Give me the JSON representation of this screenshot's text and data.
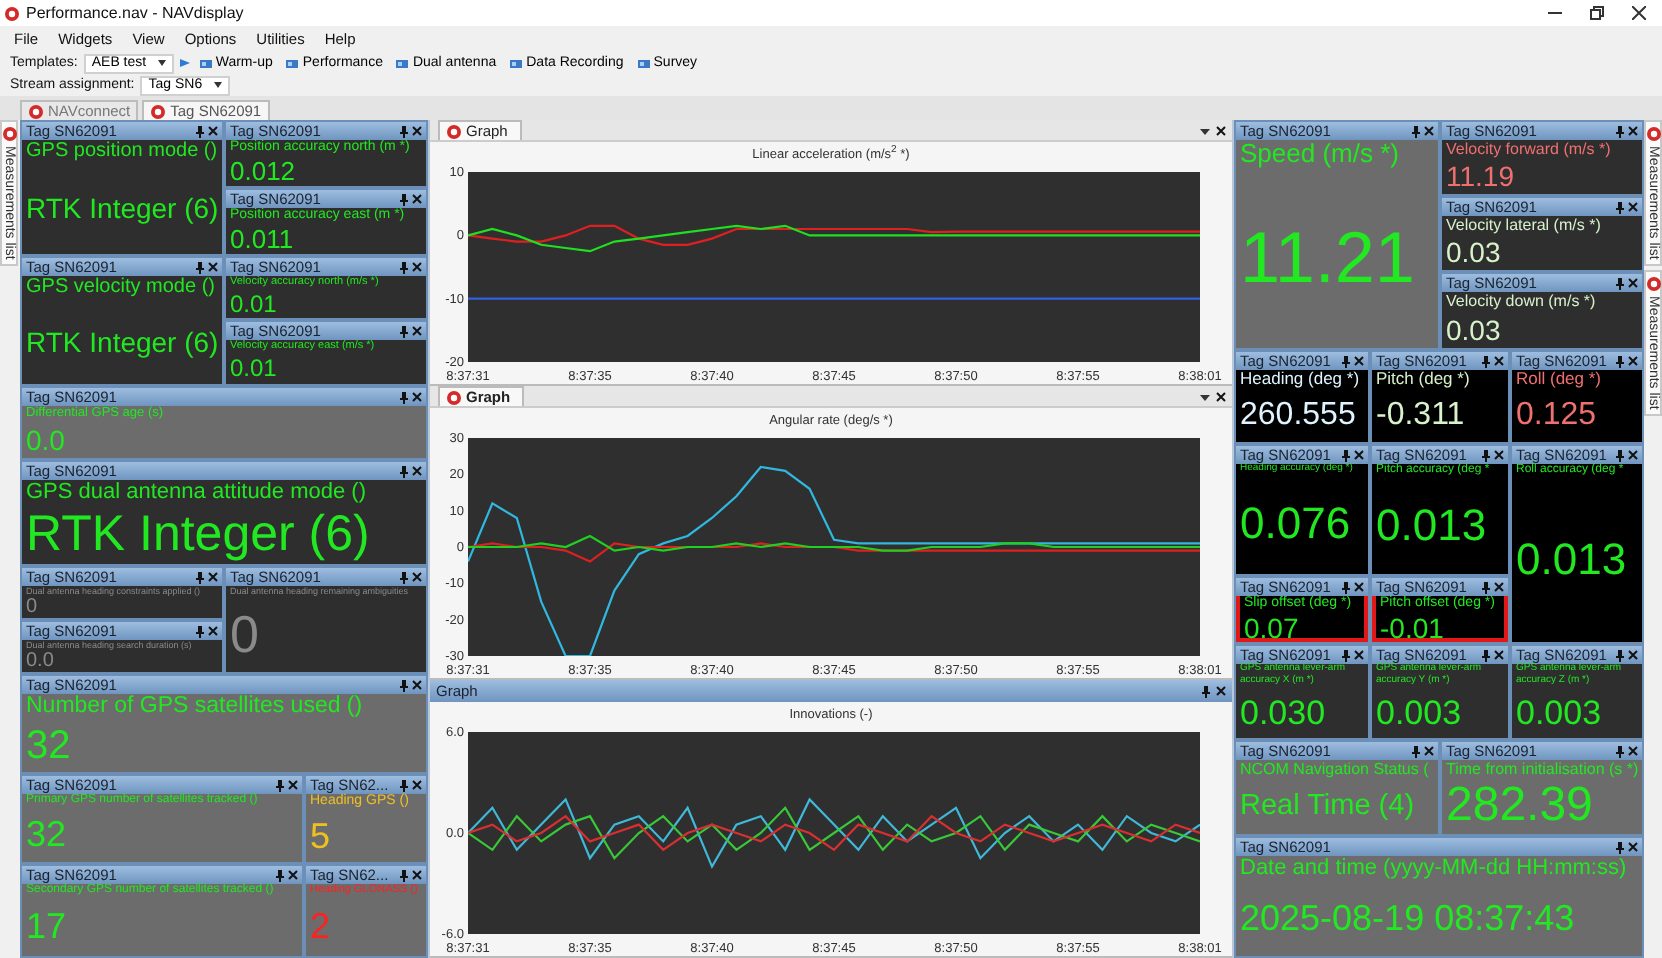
{
  "window": {
    "title": "Performance.nav - NAVdisplay"
  },
  "menu": [
    "File",
    "Widgets",
    "View",
    "Options",
    "Utilities",
    "Help"
  ],
  "toolbar": {
    "templates_label": "Templates:",
    "template": "AEB test",
    "buttons": [
      "Warm-up",
      "Performance",
      "Dual antenna",
      "Data Recording",
      "Survey"
    ],
    "stream_label": "Stream assignment:",
    "stream": "Tag SN6"
  },
  "doc_tabs": [
    {
      "label": "NAVconnect",
      "selected": false
    },
    {
      "label": "Tag SN62091",
      "selected": true
    }
  ],
  "side_tabs": {
    "left": [
      "Measurements list"
    ],
    "right": [
      "Measurements list",
      "Measurements list"
    ]
  },
  "left_widgets": [
    {
      "tag": "Tag SN62091",
      "label": "GPS position mode ()",
      "value": "RTK Integer (6)",
      "color": "#22e822",
      "kind": "dark",
      "highlighted": false
    },
    {
      "tag": "Tag SN62091",
      "label": "Position accuracy north (m *)",
      "value": "0.012",
      "color": "#22e822",
      "kind": "dark",
      "highlighted": false
    },
    {
      "tag": "Tag SN62091",
      "label": "Position accuracy east (m *)",
      "value": "0.011",
      "color": "#22e822",
      "kind": "dark",
      "highlighted": false
    },
    {
      "tag": "Tag SN62091",
      "label": "GPS velocity mode ()",
      "value": "RTK Integer (6)",
      "color": "#22e822",
      "kind": "dark",
      "highlighted": false
    },
    {
      "tag": "Tag SN62091",
      "label": "Velocity accuracy north (m/s *)",
      "value": "0.01",
      "color": "#22e822",
      "kind": "dark",
      "highlighted": false
    },
    {
      "tag": "Tag SN62091",
      "label": "Velocity accuracy east (m/s *)",
      "value": "0.01",
      "color": "#22e822",
      "kind": "dark",
      "highlighted": false
    },
    {
      "tag": "Tag SN62091",
      "label": "Differential GPS age (s)",
      "value": "0.0",
      "color": "#22e822",
      "kind": "gray",
      "highlighted": false
    },
    {
      "tag": "Tag SN62091",
      "label": "GPS dual antenna attitude mode ()",
      "value": "RTK Integer (6)",
      "color": "#22e822",
      "kind": "dark",
      "highlighted": false
    },
    {
      "tag": "Tag SN62091",
      "label": "Dual antenna heading constraints applied ()",
      "value": "0",
      "color": "#8a8a8a",
      "kind": "dark",
      "highlighted": false
    },
    {
      "tag": "Tag SN62091",
      "label": "Dual antenna heading remaining ambiguities",
      "value": "0",
      "color": "#8a8a8a",
      "kind": "dark",
      "highlighted": false
    },
    {
      "tag": "Tag SN62091",
      "label": "Dual antenna heading search duration (s)",
      "value": "0.0",
      "color": "#8a8a8a",
      "kind": "dark",
      "highlighted": false
    },
    {
      "tag": "Tag SN62091",
      "label": "Number of GPS satellites used ()",
      "value": "32",
      "color": "#22e822",
      "kind": "gray",
      "highlighted": false
    },
    {
      "tag": "Tag SN62091",
      "label": "Primary GPS number of satellites tracked ()",
      "value": "32",
      "color": "#22e822",
      "kind": "gray",
      "highlighted": false
    },
    {
      "tag": "Tag SN62...",
      "label": "Heading GPS ()",
      "value": "5",
      "color": "#f0c020",
      "kind": "gray",
      "highlighted": false
    },
    {
      "tag": "Tag SN62091",
      "label": "Secondary GPS number of satellites tracked ()",
      "value": "17",
      "color": "#22e822",
      "kind": "gray",
      "highlighted": false
    },
    {
      "tag": "Tag SN62...",
      "label": "Heading GLONASS ()",
      "value": "2",
      "color": "#ff2020",
      "kind": "gray",
      "highlighted": false
    }
  ],
  "graphs": [
    {
      "kind": "tabbed",
      "tab": "Graph",
      "selected": false,
      "chart_data": {
        "type": "line",
        "title": "Linear acceleration (m/s$^{2}$ *)",
        "categories": [
          "8:37:31",
          null,
          null,
          null,
          null,
          "8:37:35",
          null,
          null,
          null,
          null,
          "8:37:40",
          null,
          null,
          null,
          null,
          "8:37:45",
          null,
          null,
          null,
          null,
          "8:37:50",
          null,
          null,
          null,
          null,
          "8:37:55",
          null,
          null,
          null,
          null,
          "8:38:01"
        ],
        "ylim": [
          -20,
          10
        ],
        "yticks": [
          -20,
          -10,
          0,
          10
        ],
        "series": [
          {
            "color": "#e02020",
            "values": [
              0,
              -0.5,
              -1,
              -1,
              0,
              1.5,
              1.5,
              -0.5,
              -1.5,
              -1.5,
              -0.5,
              1,
              1,
              1,
              1,
              1,
              1,
              1,
              1,
              0.5,
              0.6,
              0.6,
              0.6,
              0.6,
              0.6,
              0.6,
              0.6,
              0.6,
              0.6,
              0.6,
              0.6
            ]
          },
          {
            "color": "#20e020",
            "values": [
              0,
              1,
              0,
              -1.5,
              -2,
              -2.5,
              -1,
              -0.5,
              0,
              0.5,
              1,
              1.5,
              1,
              1.5,
              0,
              0,
              0,
              0,
              0,
              0,
              0,
              0,
              0,
              0,
              0,
              0,
              0,
              0,
              0,
              0,
              0
            ]
          },
          {
            "color": "#3060e0",
            "values": [
              -10,
              -10,
              -10,
              -10,
              -10,
              -10,
              -10,
              -10,
              -10,
              -10,
              -10,
              -10,
              -10,
              -10,
              -10,
              -10,
              -10,
              -10,
              -10,
              -10,
              -10,
              -10,
              -10,
              -10,
              -10,
              -10,
              -10,
              -10,
              -10,
              -10,
              -10
            ]
          }
        ]
      }
    },
    {
      "kind": "tabbed",
      "tab": "Graph",
      "selected": true,
      "chart_data": {
        "type": "line",
        "title": "Angular rate (deg/s *)",
        "categories": [
          "8:37:31",
          null,
          null,
          null,
          null,
          "8:37:35",
          null,
          null,
          null,
          null,
          "8:37:40",
          null,
          null,
          null,
          null,
          "8:37:45",
          null,
          null,
          null,
          null,
          "8:37:50",
          null,
          null,
          null,
          null,
          "8:37:55",
          null,
          null,
          null,
          null,
          "8:38:01"
        ],
        "ylim": [
          -30,
          30
        ],
        "yticks": [
          -30,
          -20,
          -10,
          0,
          10,
          20,
          30
        ],
        "series": [
          {
            "color": "#30b8e0",
            "values": [
              -4,
              12,
              8,
              -15,
              -30,
              -30,
              -12,
              -2,
              1,
              3,
              8,
              14,
              22,
              21,
              16,
              2,
              1,
              1,
              1,
              1,
              1,
              1,
              1,
              1,
              1,
              1,
              1,
              1,
              1,
              1,
              1
            ]
          },
          {
            "color": "#e02020",
            "values": [
              0,
              1,
              0,
              0,
              -1,
              -4,
              1,
              0,
              0,
              0,
              0,
              0,
              1,
              0,
              0,
              0,
              -1,
              -1,
              -1,
              -1,
              -1,
              -1,
              -1,
              -1,
              -1,
              -1,
              -1,
              -1,
              -1,
              -1,
              -1
            ]
          },
          {
            "color": "#20d020",
            "values": [
              0,
              0,
              0,
              1,
              0,
              3,
              -1,
              0,
              -1,
              0,
              0,
              1,
              0,
              1,
              0,
              0,
              0,
              -1,
              -1,
              0,
              0,
              0,
              1,
              1,
              0,
              0,
              0,
              0,
              0,
              0,
              0
            ]
          }
        ]
      }
    },
    {
      "kind": "bar",
      "tab": "Graph",
      "chart_data": {
        "type": "line",
        "title": "Innovations (-)",
        "categories": [
          "8:37:31",
          null,
          null,
          null,
          null,
          "8:37:35",
          null,
          null,
          null,
          null,
          "8:37:40",
          null,
          null,
          null,
          null,
          "8:37:45",
          null,
          null,
          null,
          null,
          "8:37:50",
          null,
          null,
          null,
          null,
          "8:37:55",
          null,
          null,
          null,
          null,
          "8:38:01"
        ],
        "ylim": [
          -6,
          6
        ],
        "yticks": [
          {
            "value": -6,
            "label": "-6.0"
          },
          {
            "value": 0,
            "label": "0.0"
          },
          {
            "value": 6,
            "label": "6.0"
          }
        ],
        "series": [
          {
            "color": "#40b8d8",
            "values": [
              0,
              1.5,
              -1,
              0.5,
              2,
              -1.5,
              0.5,
              1,
              -0.5,
              1.5,
              -2,
              0.5,
              1,
              -1,
              2,
              0.5,
              -1,
              1,
              -0.5,
              0.5,
              1.5,
              -1.5,
              0,
              1,
              -0.5,
              0.5,
              -1,
              1,
              0,
              -0.5,
              0.5
            ]
          },
          {
            "color": "#38c838",
            "values": [
              0,
              -1,
              1,
              -0.5,
              0.5,
              1,
              -1.5,
              0,
              1,
              -0.5,
              0.5,
              -1,
              0,
              1.5,
              -1,
              0,
              1,
              -1,
              0.5,
              -0.5,
              0,
              1,
              -1,
              0.5,
              0,
              -0.5,
              1,
              -0.5,
              0.5,
              0,
              -0.5
            ]
          },
          {
            "color": "#d83030",
            "values": [
              0,
              0.5,
              -0.5,
              0,
              1,
              -0.5,
              0,
              0.5,
              -1,
              0,
              0.5,
              0,
              -0.5,
              0.5,
              0,
              -1,
              0.5,
              0,
              -0.5,
              1,
              0,
              -0.5,
              0.5,
              0,
              -0.5,
              0,
              0.5,
              0,
              -0.5,
              0.5,
              0
            ]
          }
        ]
      }
    }
  ],
  "right_widgets": [
    {
      "tag": "Tag SN62091",
      "label": "Speed (m/s *)",
      "value": "11.21",
      "color": "#22e822",
      "kind": "gray",
      "highlighted": false
    },
    {
      "tag": "Tag SN62091",
      "label": "Velocity forward (m/s *)",
      "value": "11.19",
      "color": "#f07070",
      "kind": "dark",
      "highlighted": false
    },
    {
      "tag": "Tag SN62091",
      "label": "Velocity lateral (m/s *)",
      "value": "0.03",
      "color": "#d8f2cc",
      "kind": "dark",
      "highlighted": false
    },
    {
      "tag": "Tag SN62091",
      "label": "Velocity down (m/s *)",
      "value": "0.03",
      "color": "#d8f2cc",
      "kind": "dark",
      "highlighted": false
    },
    {
      "tag": "Tag SN62091",
      "label": "Heading (deg *)",
      "value": "260.555",
      "color": "#e0f4ff",
      "kind": "black",
      "highlighted": false
    },
    {
      "tag": "Tag SN62091",
      "label": "Pitch (deg *)",
      "value": "-0.311",
      "color": "#d8f2cc",
      "kind": "black",
      "highlighted": false
    },
    {
      "tag": "Tag SN62091",
      "label": "Roll (deg *)",
      "value": "0.125",
      "color": "#f07070",
      "kind": "black",
      "highlighted": false
    },
    {
      "tag": "Tag SN62091",
      "label": "Heading accuracy (deg *)",
      "value": "0.076",
      "color": "#22e822",
      "kind": "black",
      "highlighted": false
    },
    {
      "tag": "Tag SN62091",
      "label": "Pitch accuracy (deg *",
      "value": "0.013",
      "color": "#22e822",
      "kind": "black",
      "highlighted": false
    },
    {
      "tag": "Tag SN62091",
      "label": "Roll accuracy (deg *",
      "value": "0.013",
      "color": "#22e822",
      "kind": "black",
      "highlighted": false
    },
    {
      "tag": "Tag SN62091",
      "label": "Slip offset (deg *)",
      "value": "0.07",
      "color": "#22e822",
      "kind": "black",
      "highlighted": true
    },
    {
      "tag": "Tag SN62091",
      "label": "Pitch offset (deg *)",
      "value": "-0.01",
      "color": "#22e822",
      "kind": "black",
      "highlighted": true
    },
    {
      "tag": "Tag SN62091",
      "label": "GPS antenna lever-arm accuracy X (m *)",
      "value": "0.030",
      "color": "#22e822",
      "kind": "dark",
      "highlighted": false
    },
    {
      "tag": "Tag SN62091",
      "label": "GPS antenna lever-arm accuracy Y (m *)",
      "value": "0.003",
      "color": "#22e822",
      "kind": "dark",
      "highlighted": false
    },
    {
      "tag": "Tag SN62091",
      "label": "GPS antenna lever-arm accuracy Z (m *)",
      "value": "0.003",
      "color": "#22e822",
      "kind": "dark",
      "highlighted": false
    },
    {
      "tag": "Tag SN62091",
      "label": "NCOM Navigation Status (",
      "value": "Real Time (4)",
      "color": "#22e822",
      "kind": "gray",
      "highlighted": false
    },
    {
      "tag": "Tag SN62091",
      "label": "Time from initialisation (s *)",
      "value": "282.39",
      "color": "#22e822",
      "kind": "gray",
      "highlighted": false
    },
    {
      "tag": "Tag SN62091",
      "label": "Date and time (yyyy-MM-dd HH:mm:ss)",
      "value": "2025-08-19 08:37:43",
      "color": "#22e822",
      "kind": "gray",
      "highlighted": false
    }
  ]
}
